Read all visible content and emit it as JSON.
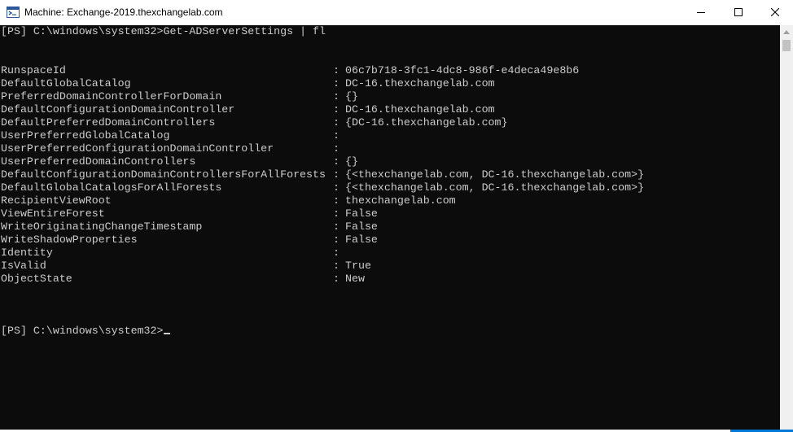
{
  "window": {
    "title": "Machine: Exchange-2019.thexchangelab.com",
    "icon": "powershell-machine-icon"
  },
  "console": {
    "command_prompt": "[PS] C:\\windows\\system32>",
    "command": "Get-ADServerSettings | fl",
    "separator": ":",
    "properties": [
      {
        "name": "RunspaceId",
        "value": "06c7b718-3fc1-4dc8-986f-e4deca49e8b6"
      },
      {
        "name": "DefaultGlobalCatalog",
        "value": "DC-16.thexchangelab.com"
      },
      {
        "name": "PreferredDomainControllerForDomain",
        "value": "{}"
      },
      {
        "name": "DefaultConfigurationDomainController",
        "value": "DC-16.thexchangelab.com"
      },
      {
        "name": "DefaultPreferredDomainControllers",
        "value": "{DC-16.thexchangelab.com}"
      },
      {
        "name": "UserPreferredGlobalCatalog",
        "value": ""
      },
      {
        "name": "UserPreferredConfigurationDomainController",
        "value": ""
      },
      {
        "name": "UserPreferredDomainControllers",
        "value": "{}"
      },
      {
        "name": "DefaultConfigurationDomainControllersForAllForests",
        "value": "{<thexchangelab.com, DC-16.thexchangelab.com>}"
      },
      {
        "name": "DefaultGlobalCatalogsForAllForests",
        "value": "{<thexchangelab.com, DC-16.thexchangelab.com>}"
      },
      {
        "name": "RecipientViewRoot",
        "value": "thexchangelab.com"
      },
      {
        "name": "ViewEntireForest",
        "value": "False"
      },
      {
        "name": "WriteOriginatingChangeTimestamp",
        "value": "False"
      },
      {
        "name": "WriteShadowProperties",
        "value": "False"
      },
      {
        "name": "Identity",
        "value": ""
      },
      {
        "name": "IsValid",
        "value": "True"
      },
      {
        "name": "ObjectState",
        "value": "New"
      }
    ],
    "final_prompt": "[PS] C:\\windows\\system32>"
  },
  "colors": {
    "console_bg": "#0c0c0c",
    "console_text": "#cccccc",
    "accent": "#0078d7"
  }
}
